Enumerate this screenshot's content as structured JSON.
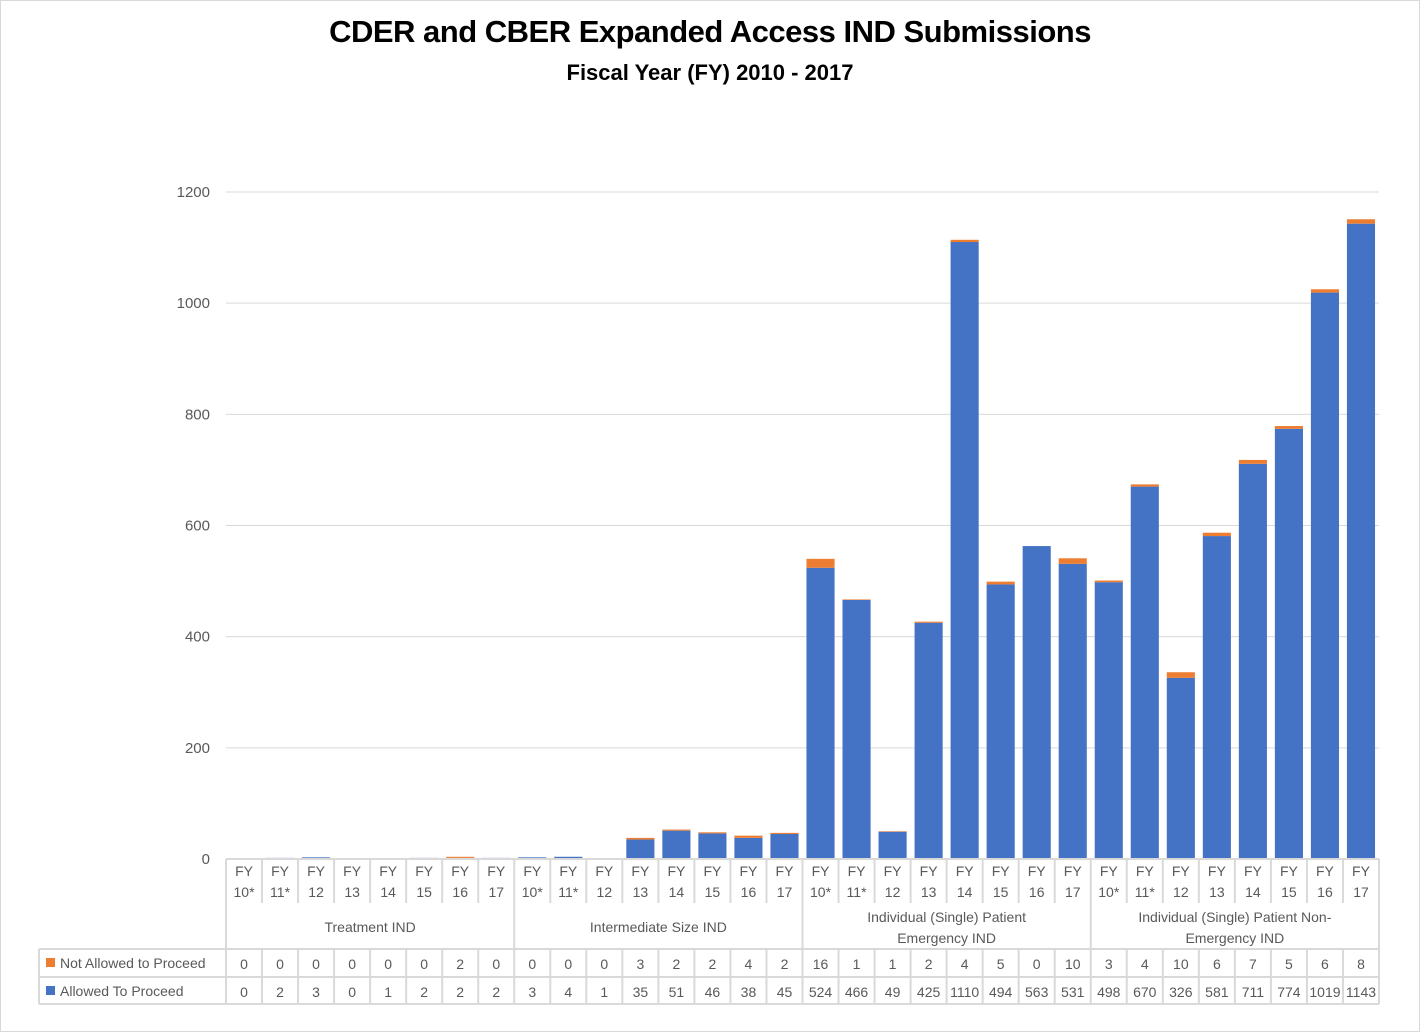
{
  "chart_data": {
    "type": "bar",
    "stacked": true,
    "title": "CDER and CBER Expanded Access IND Submissions",
    "subtitle": "Fiscal Year (FY) 2010 - 2017",
    "xlabel": "",
    "ylabel": "",
    "ylim": [
      0,
      1200
    ],
    "yticks": [
      0,
      200,
      400,
      600,
      800,
      1000,
      1200
    ],
    "grid": true,
    "legend": "data-table-left",
    "groups": [
      {
        "name": "Treatment IND",
        "lines": [
          "Treatment IND"
        ]
      },
      {
        "name": "Intermediate Size IND",
        "lines": [
          "Intermediate Size IND"
        ]
      },
      {
        "name": "Individual (Single) Patient Emergency IND",
        "lines": [
          "Individual (Single) Patient",
          "Emergency IND"
        ]
      },
      {
        "name": "Individual (Single) Patient Non-Emergency IND",
        "lines": [
          "Individual (Single) Patient Non-",
          "Emergency IND"
        ]
      }
    ],
    "year_labels": [
      [
        "FY",
        "10*"
      ],
      [
        "FY",
        "11*"
      ],
      [
        "FY",
        "12"
      ],
      [
        "FY",
        "13"
      ],
      [
        "FY",
        "14"
      ],
      [
        "FY",
        "15"
      ],
      [
        "FY",
        "16"
      ],
      [
        "FY",
        "17"
      ]
    ],
    "categories": [
      "Treatment IND FY10*",
      "Treatment IND FY11*",
      "Treatment IND FY12",
      "Treatment IND FY13",
      "Treatment IND FY14",
      "Treatment IND FY15",
      "Treatment IND FY16",
      "Treatment IND FY17",
      "Intermediate Size IND FY10*",
      "Intermediate Size IND FY11*",
      "Intermediate Size IND FY12",
      "Intermediate Size IND FY13",
      "Intermediate Size IND FY14",
      "Intermediate Size IND FY15",
      "Intermediate Size IND FY16",
      "Intermediate Size IND FY17",
      "Emergency IND FY10*",
      "Emergency IND FY11*",
      "Emergency IND FY12",
      "Emergency IND FY13",
      "Emergency IND FY14",
      "Emergency IND FY15",
      "Emergency IND FY16",
      "Emergency IND FY17",
      "Non-Emergency IND FY10*",
      "Non-Emergency IND FY11*",
      "Non-Emergency IND FY12",
      "Non-Emergency IND FY13",
      "Non-Emergency IND FY14",
      "Non-Emergency IND FY15",
      "Non-Emergency IND FY16",
      "Non-Emergency IND FY17"
    ],
    "series": [
      {
        "name": "Not Allowed to Proceed",
        "color": "#ED7D31",
        "values": [
          0,
          0,
          0,
          0,
          0,
          0,
          2,
          0,
          0,
          0,
          0,
          3,
          2,
          2,
          4,
          2,
          16,
          1,
          1,
          2,
          4,
          5,
          0,
          10,
          3,
          4,
          10,
          6,
          7,
          5,
          6,
          8
        ]
      },
      {
        "name": "Allowed To Proceed",
        "color": "#4472C4",
        "values": [
          0,
          2,
          3,
          0,
          1,
          2,
          2,
          2,
          3,
          4,
          1,
          35,
          51,
          46,
          38,
          45,
          524,
          466,
          49,
          425,
          1110,
          494,
          563,
          531,
          498,
          670,
          326,
          581,
          711,
          774,
          1019,
          1143
        ]
      }
    ],
    "stack_order_bottom_to_top": [
      "Allowed To Proceed",
      "Not Allowed to Proceed"
    ]
  }
}
